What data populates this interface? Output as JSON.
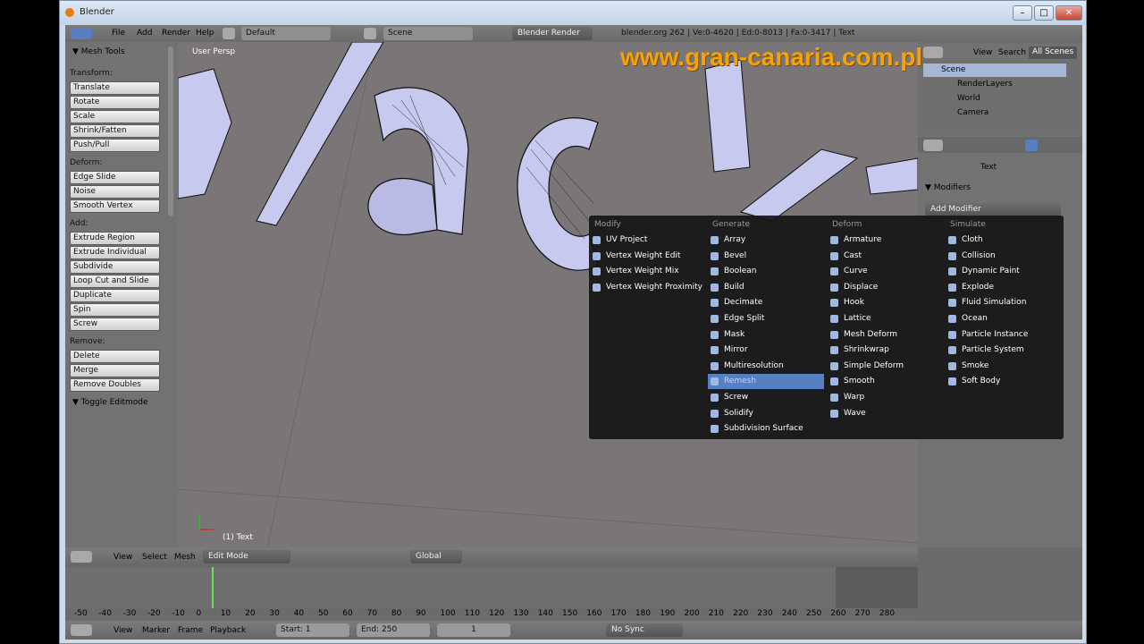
{
  "window": {
    "title": "Blender",
    "min": "–",
    "max": "□",
    "close": "✕"
  },
  "topbar": {
    "menus": [
      "File",
      "Add",
      "Render",
      "Help"
    ],
    "layout": "Default",
    "scene": "Scene",
    "engine": "Blender Render",
    "stats": "blender.org 262 | Ve:0-4620 | Ed:0-8013 | Fa:0-3417 | Text"
  },
  "watermark": "www.gran-canaria.com.pl",
  "toolshelf": {
    "title": "Mesh Tools",
    "groups": [
      {
        "label": "Transform:",
        "items": [
          "Translate",
          "Rotate",
          "Scale",
          "Shrink/Fatten",
          "Push/Pull"
        ]
      },
      {
        "label": "Deform:",
        "items": [
          "Edge Slide",
          "Noise",
          "Smooth Vertex"
        ]
      },
      {
        "label": "Add:",
        "items": [
          "Extrude Region",
          "Extrude Individual",
          "Subdivide",
          "Loop Cut and Slide",
          "Duplicate",
          "Spin",
          "Screw"
        ]
      },
      {
        "label": "Remove:",
        "items": [
          "Delete",
          "Merge",
          "Remove Doubles"
        ]
      }
    ],
    "toggle": "Toggle Editmode"
  },
  "viewport": {
    "view_label": "User Persp",
    "object_label": "(1) Text"
  },
  "outliner": {
    "view": "View",
    "search": "Search",
    "all_scenes": "All Scenes",
    "items": [
      "Scene",
      "RenderLayers",
      "World",
      "Camera"
    ]
  },
  "props": {
    "object": "Text",
    "modifiers": "Modifiers",
    "add_modifier": "Add Modifier"
  },
  "menu": {
    "columns": [
      {
        "title": "Modify",
        "items": [
          "UV Project",
          "Vertex Weight Edit",
          "Vertex Weight Mix",
          "Vertex Weight Proximity"
        ]
      },
      {
        "title": "Generate",
        "items": [
          "Array",
          "Bevel",
          "Boolean",
          "Build",
          "Decimate",
          "Edge Split",
          "Mask",
          "Mirror",
          "Multiresolution",
          "Remesh",
          "Screw",
          "Solidify",
          "Subdivision Surface"
        ]
      },
      {
        "title": "Deform",
        "items": [
          "Armature",
          "Cast",
          "Curve",
          "Displace",
          "Hook",
          "Lattice",
          "Mesh Deform",
          "Shrinkwrap",
          "Simple Deform",
          "Smooth",
          "Warp",
          "Wave"
        ]
      },
      {
        "title": "Simulate",
        "items": [
          "Cloth",
          "Collision",
          "Dynamic Paint",
          "Explode",
          "Fluid Simulation",
          "Ocean",
          "Particle Instance",
          "Particle System",
          "Smoke",
          "Soft Body"
        ]
      }
    ],
    "selected": "Remesh"
  },
  "header3d": {
    "view": "View",
    "select": "Select",
    "mesh": "Mesh",
    "mode": "Edit Mode",
    "orientation": "Global"
  },
  "timeline": {
    "ticks": [
      "-50",
      "-40",
      "-30",
      "-20",
      "-10",
      "0",
      "10",
      "20",
      "30",
      "40",
      "50",
      "60",
      "70",
      "80",
      "90",
      "100",
      "110",
      "120",
      "130",
      "140",
      "150",
      "160",
      "170",
      "180",
      "190",
      "200",
      "210",
      "220",
      "230",
      "240",
      "250",
      "260",
      "270",
      "280"
    ]
  },
  "bottombar": {
    "view": "View",
    "marker": "Marker",
    "frame": "Frame",
    "playback": "Playback",
    "start": "Start: 1",
    "end": "End: 250",
    "current": "1",
    "sync": "No Sync"
  },
  "colors": {
    "accent": "#5680c2",
    "watermark": "#f2a20c",
    "menu_bg": "#161616"
  }
}
